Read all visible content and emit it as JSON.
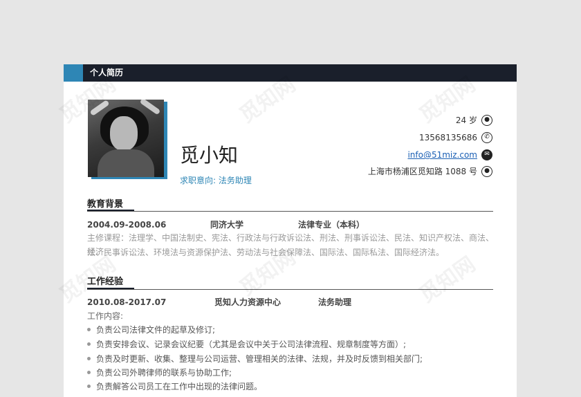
{
  "header": {
    "title": "个人简历"
  },
  "profile": {
    "name": "觅小知",
    "intent_label": "求职意向:",
    "intent_value": "法务助理",
    "age": "24 岁",
    "phone": "13568135686",
    "email": "info@51miz.com",
    "address": "上海市杨浦区觅知路 1088 号"
  },
  "education": {
    "title": "教育背景",
    "period": "2004.09-2008.06",
    "school": "同济大学",
    "major": "法律专业（本科）",
    "courses_line1": "主修课程：法理学、中国法制史、宪法、行政法与行政诉讼法、刑法、刑事诉讼法、民法、知识产权法、商法、经济",
    "courses_line2": "法、民事诉讼法、环境法与资源保护法、劳动法与社会保障法、国际法、国际私法、国际经济法。"
  },
  "work": {
    "title": "工作经验",
    "period": "2010.08-2017.07",
    "company": "觅知人力资源中心",
    "position": "法务助理",
    "content_label": "工作内容:",
    "duties": [
      "负责公司法律文件的起草及修订;",
      "负责安排会议、记录会议纪要（尤其是会议中关于公司法律流程、规章制度等方面）;",
      "负责及时更新、收集、整理与公司运营、管理相关的法律、法规，并及时反馈到相关部门;",
      "负责公司外聘律师的联系与协助工作;",
      "负责解答公司员工在工作中出现的法律问题。"
    ]
  },
  "icons": [
    "person-icon",
    "phone-icon",
    "mail-icon",
    "location-icon"
  ],
  "watermark": "觅知网",
  "colors": {
    "accent": "#2e86b5",
    "dark": "#1a1f2b",
    "link": "#1a5fb4"
  }
}
